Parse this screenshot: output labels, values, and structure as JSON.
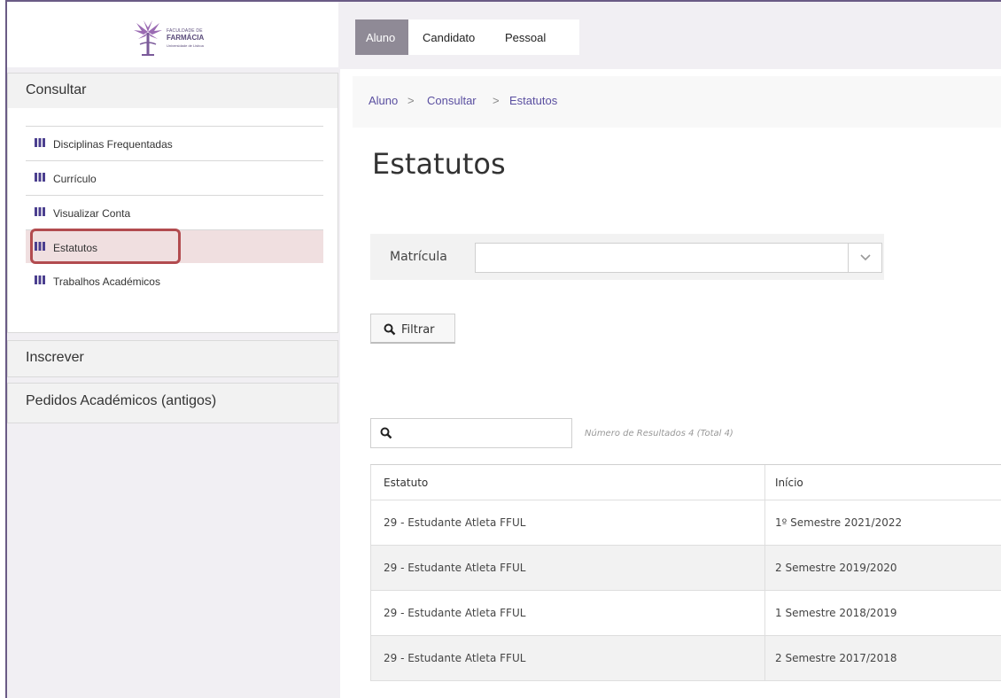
{
  "logo": {
    "line1": "FACULDADE DE",
    "line2": "FARMÁCIA",
    "line3": "Universidade de Lisboa"
  },
  "sidebar": {
    "sections": [
      {
        "label": "Consultar"
      },
      {
        "label": "Inscrever"
      },
      {
        "label": "Pedidos Académicos (antigos)"
      }
    ],
    "items": [
      {
        "label": "Disciplinas Frequentadas"
      },
      {
        "label": "Currículo"
      },
      {
        "label": "Visualizar Conta"
      },
      {
        "label": "Estatutos"
      },
      {
        "label": "Trabalhos Académicos"
      }
    ]
  },
  "tabs": [
    {
      "label": "Aluno"
    },
    {
      "label": "Candidato"
    },
    {
      "label": "Pessoal"
    }
  ],
  "breadcrumb": {
    "items": [
      "Aluno",
      "Consultar",
      "Estatutos"
    ],
    "separator": ">"
  },
  "page": {
    "title": "Estatutos"
  },
  "filter": {
    "label": "Matrícula",
    "value": "",
    "button": "Filtrar"
  },
  "search": {
    "value": "",
    "results": "Número de Resultados 4 (Total 4)"
  },
  "table": {
    "columns": [
      "Estatuto",
      "Início"
    ],
    "rows": [
      [
        "29 - Estudante Atleta FFUL",
        "1º Semestre 2021/2022"
      ],
      [
        "29 - Estudante Atleta FFUL",
        "2 Semestre 2019/2020"
      ],
      [
        "29 - Estudante Atleta FFUL",
        "1 Semestre 2018/2019"
      ],
      [
        "29 - Estudante Atleta FFUL",
        "2 Semestre 2017/2018"
      ]
    ]
  },
  "colors": {
    "accent": "#5a4fa0",
    "active_tab": "#8f8a96",
    "highlight_border": "#b24b4f",
    "active_item_bg": "#f0dfe0"
  }
}
